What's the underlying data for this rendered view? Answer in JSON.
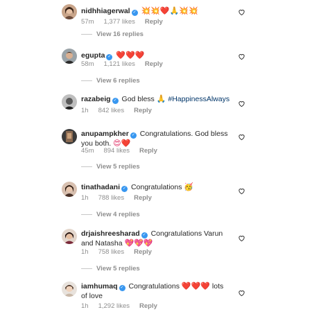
{
  "comments": [
    {
      "username": "nidhhiagerwal",
      "text": "",
      "emoji": "💥💥❤️🙏💥💥",
      "time": "57m",
      "likes": "1,377 likes",
      "reply": "Reply",
      "view_replies": "View 16 replies"
    },
    {
      "username": "egupta",
      "text": "",
      "emoji": "❤️❤️❤️",
      "time": "58m",
      "likes": "1,121 likes",
      "reply": "Reply",
      "view_replies": "View 6 replies"
    },
    {
      "username": "razabeig",
      "text": "God bless",
      "emoji": "🙏",
      "hashtag": "#HappinessAlways",
      "time": "1h",
      "likes": "842 likes",
      "reply": "Reply"
    },
    {
      "username": "anupampkher",
      "text": "Congratulations. God bless you both.",
      "emoji": "😍❤️",
      "time": "45m",
      "likes": "894 likes",
      "reply": "Reply",
      "view_replies": "View 5 replies"
    },
    {
      "username": "tinathadani",
      "text": "Congratulations",
      "emoji": "🥳",
      "time": "1h",
      "likes": "788 likes",
      "reply": "Reply",
      "view_replies": "View 4 replies"
    },
    {
      "username": "drjaishreesharad",
      "text": "Congratulations Varun and Natasha",
      "emoji": "💖💖💖",
      "time": "1h",
      "likes": "758 likes",
      "reply": "Reply",
      "view_replies": "View 5 replies"
    },
    {
      "username": "iamhumaq",
      "text": "Congratulations",
      "emoji": "❤️❤️❤️",
      "text2": "lots of love",
      "time": "1h",
      "likes": "1,292 likes",
      "reply": "Reply"
    }
  ]
}
